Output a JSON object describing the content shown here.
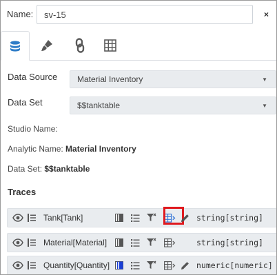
{
  "header": {
    "name_label": "Name:",
    "name_value": "sv-15",
    "close_label": "×"
  },
  "tabs": [
    {
      "icon": "database-icon",
      "active": true
    },
    {
      "icon": "paintbrush-icon",
      "active": false
    },
    {
      "icon": "link-icon",
      "active": false
    },
    {
      "icon": "table-icon",
      "active": false
    }
  ],
  "form": {
    "data_source_label": "Data Source",
    "data_source_value": "Material Inventory",
    "data_set_label": "Data Set",
    "data_set_value": "$$tanktable"
  },
  "info": {
    "studio_name_label": "Studio Name:",
    "analytic_name_label": "Analytic Name:",
    "analytic_name_value": "Material Inventory",
    "data_set_label": "Data Set:",
    "data_set_value": "$$tanktable"
  },
  "traces": {
    "title": "Traces",
    "rows": [
      {
        "name": "Tank[Tank]",
        "type": "string[string]",
        "color": "#555555",
        "show_pencil": true
      },
      {
        "name": "Material[Material]",
        "type": "string[string]",
        "color": "#555555",
        "show_pencil": false
      },
      {
        "name": "Quantity[Quantity]",
        "type": "numeric[numeric]",
        "color": "#1a3fd6",
        "show_pencil": true
      }
    ]
  },
  "colors": {
    "highlight": "#e0191e",
    "icon": "#555555"
  }
}
